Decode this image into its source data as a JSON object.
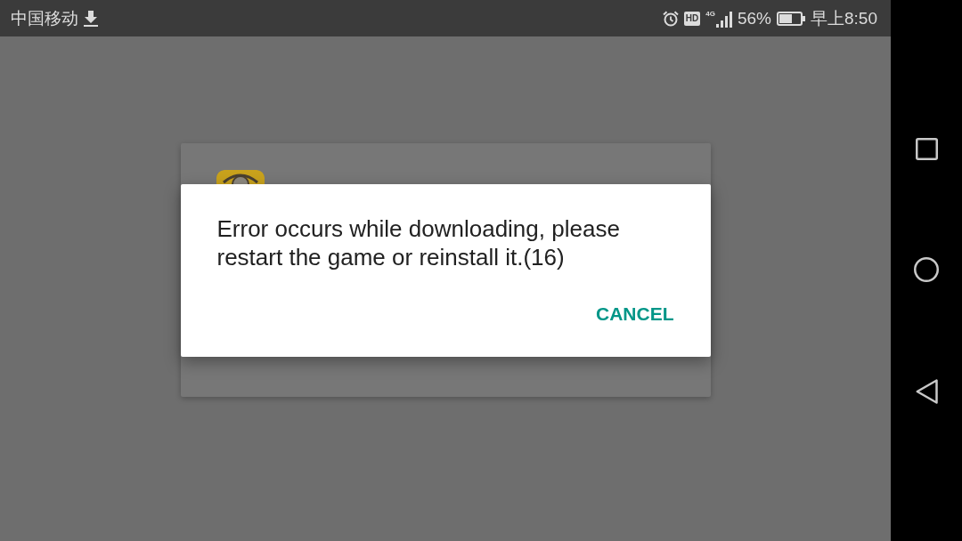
{
  "status_bar": {
    "carrier": "中国移动",
    "hd_badge": "HD",
    "network_type": "4G",
    "battery_percent": "56%",
    "time": "早上8:50"
  },
  "dialog": {
    "message": "Error occurs while downloading, please restart the game or reinstall it.(16)",
    "buttons": [
      {
        "label": "CANCEL"
      }
    ]
  }
}
